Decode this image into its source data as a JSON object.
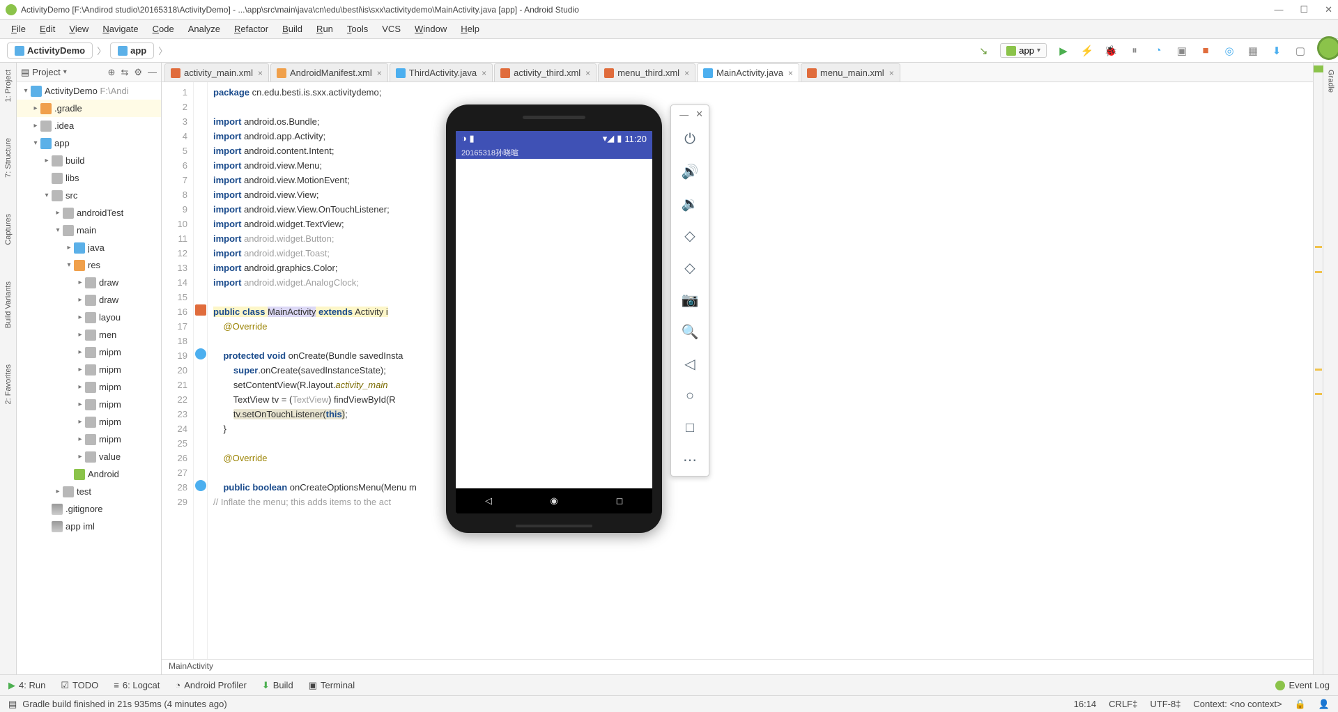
{
  "window": {
    "title": "ActivityDemo [F:\\Andirod studio\\20165318\\ActivityDemo] - ...\\app\\src\\main\\java\\cn\\edu\\besti\\is\\sxx\\activitydemo\\MainActivity.java [app] - Android Studio"
  },
  "menu": [
    "File",
    "Edit",
    "View",
    "Navigate",
    "Code",
    "Analyze",
    "Refactor",
    "Build",
    "Run",
    "Tools",
    "VCS",
    "Window",
    "Help"
  ],
  "menu_u": [
    "F",
    "E",
    "V",
    "N",
    "C",
    "",
    "R",
    "B",
    "R",
    "T",
    "",
    "W",
    "H"
  ],
  "breadcrumbs": {
    "root": "ActivityDemo",
    "mod": "app"
  },
  "run_config": "app",
  "left_tabs": [
    "1: Project",
    "7: Structure",
    "Captures",
    "Build Variants",
    "2: Favorites"
  ],
  "tree_header": "Project",
  "tree": [
    {
      "d": 0,
      "a": "v",
      "ic": "folder-blue",
      "t": "ActivityDemo",
      "extra": "F:\\Andi"
    },
    {
      "d": 1,
      "a": ">",
      "ic": "folder-orange",
      "t": ".gradle",
      "sel": true
    },
    {
      "d": 1,
      "a": ">",
      "ic": "folder-grey",
      "t": ".idea"
    },
    {
      "d": 1,
      "a": "v",
      "ic": "folder-blue",
      "t": "app"
    },
    {
      "d": 2,
      "a": ">",
      "ic": "folder-grey",
      "t": "build"
    },
    {
      "d": 2,
      "a": "",
      "ic": "folder-grey",
      "t": "libs"
    },
    {
      "d": 2,
      "a": "v",
      "ic": "folder-grey",
      "t": "src"
    },
    {
      "d": 3,
      "a": ">",
      "ic": "folder-grey",
      "t": "androidTest"
    },
    {
      "d": 3,
      "a": "v",
      "ic": "folder-grey",
      "t": "main"
    },
    {
      "d": 4,
      "a": ">",
      "ic": "folder-blue",
      "t": "java"
    },
    {
      "d": 4,
      "a": "v",
      "ic": "folder-orange",
      "t": "res"
    },
    {
      "d": 5,
      "a": ">",
      "ic": "folder-grey",
      "t": "draw"
    },
    {
      "d": 5,
      "a": ">",
      "ic": "folder-grey",
      "t": "draw"
    },
    {
      "d": 5,
      "a": ">",
      "ic": "folder-grey",
      "t": "layou"
    },
    {
      "d": 5,
      "a": ">",
      "ic": "folder-grey",
      "t": "men"
    },
    {
      "d": 5,
      "a": ">",
      "ic": "folder-grey",
      "t": "mipm"
    },
    {
      "d": 5,
      "a": ">",
      "ic": "folder-grey",
      "t": "mipm"
    },
    {
      "d": 5,
      "a": ">",
      "ic": "folder-grey",
      "t": "mipm"
    },
    {
      "d": 5,
      "a": ">",
      "ic": "folder-grey",
      "t": "mipm"
    },
    {
      "d": 5,
      "a": ">",
      "ic": "folder-grey",
      "t": "mipm"
    },
    {
      "d": 5,
      "a": ">",
      "ic": "folder-grey",
      "t": "mipm"
    },
    {
      "d": 5,
      "a": ">",
      "ic": "folder-grey",
      "t": "value"
    },
    {
      "d": 4,
      "a": "",
      "ic": "file",
      "t": "Android"
    },
    {
      "d": 3,
      "a": ">",
      "ic": "folder-grey",
      "t": "test"
    },
    {
      "d": 2,
      "a": "",
      "ic": "gear",
      "t": ".gitignore"
    },
    {
      "d": 2,
      "a": "",
      "ic": "gear",
      "t": "app iml"
    }
  ],
  "tabs": [
    {
      "ic": "ic-xml",
      "t": "activity_main.xml"
    },
    {
      "ic": "ic-manifest",
      "t": "AndroidManifest.xml"
    },
    {
      "ic": "ic-java",
      "t": "ThirdActivity.java"
    },
    {
      "ic": "ic-xml",
      "t": "activity_third.xml"
    },
    {
      "ic": "ic-xml",
      "t": "menu_third.xml"
    },
    {
      "ic": "ic-java",
      "t": "MainActivity.java",
      "active": true
    },
    {
      "ic": "ic-xml",
      "t": "menu_main.xml"
    }
  ],
  "code_lines": 29,
  "code_breadcrumb": "MainActivity",
  "emulator": {
    "time": "11:20",
    "app_title": "20165318孙晓暄"
  },
  "bottom": [
    "4: Run",
    "TODO",
    "6: Logcat",
    "Android Profiler",
    "Build",
    "Terminal"
  ],
  "bottom_right": "Event Log",
  "status": {
    "msg": "Gradle build finished in 21s 935ms (4 minutes ago)",
    "pos": "16:14",
    "eol": "CRLF‡",
    "enc": "UTF-8‡",
    "ctx": "Context: <no context>"
  }
}
